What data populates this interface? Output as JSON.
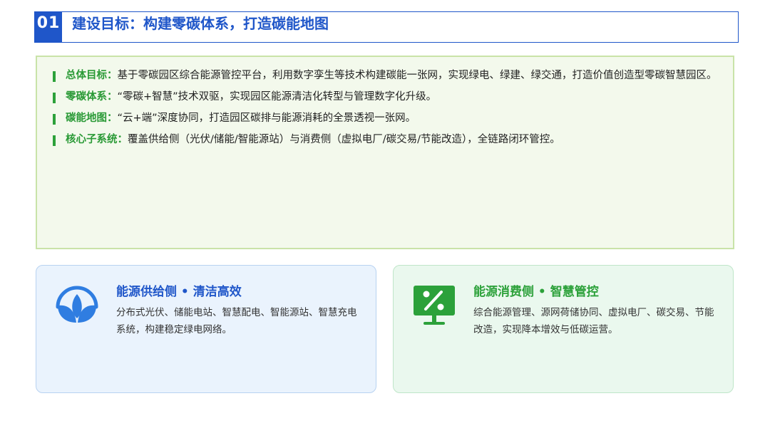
{
  "header": {
    "number": "01",
    "title": "建设目标：构建零碳体系，打造碳能地图"
  },
  "goals": [
    {
      "label": "总体目标：",
      "text": "基于零碳园区综合能源管控平台，利用数字孪生等技术构建碳能一张网，实现绿电、绿建、绿交通，打造价值创造型零碳智慧园区。"
    },
    {
      "label": "零碳体系：",
      "text": "“零碳+智慧”技术双驱，实现园区能源清洁化转型与管理数字化升级。"
    },
    {
      "label": "碳能地图：",
      "text": "“云+端”深度协同，打造园区碳排与能源消耗的全景透视一张网。"
    },
    {
      "label": "核心子系统：",
      "text": "覆盖供给侧（光伏/储能/智能源站）与消费侧（虚拟电厂/碳交易/节能改造），全链路闭环管控。"
    }
  ],
  "cards": {
    "supply": {
      "title": "能源供给侧 • 清洁高效",
      "description": "分布式光伏、储能电站、智慧配电、智能源站、智慧充电系统，构建稳定绿电网络。",
      "icon": "lotus-sun-icon"
    },
    "consume": {
      "title": "能源消费侧 • 智慧管控",
      "description": "综合能源管理、源网荷储协同、虚拟电厂、碳交易、节能改造，实现降本增效与低碳运营。",
      "icon": "percent-monitor-icon"
    }
  },
  "colors": {
    "primary_blue": "#1f56c9",
    "icon_blue": "#2f7de1",
    "primary_green": "#2ca13a",
    "panel_green_bg": "#f3f9ec",
    "card_blue_bg": "#eaf3fd",
    "card_green_bg": "#eaf8ee"
  }
}
